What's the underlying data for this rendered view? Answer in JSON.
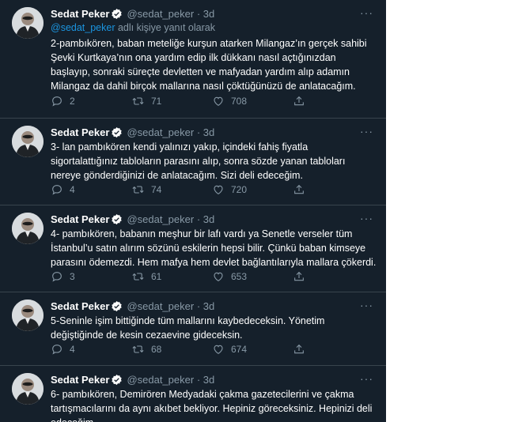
{
  "reply_prefix": {
    "mention": "@sedat_peker",
    "suffix": " adlı kişiye yanıt olarak"
  },
  "tweets": [
    {
      "name": "Sedat Peker",
      "handle": "@sedat_peker",
      "dot": "·",
      "time": "3d",
      "text": "2-pambıkören, baban meteliğe kurşun atarken Milangaz’ın gerçek sahibi Şevki Kurtkaya’nın ona yardım edip ilk dükkanı nasıl açtığınızdan başlayıp, sonraki süreçte devletten ve mafyadan yardım alıp adamın Milangaz da dahil birçok mallarına nasıl çöktüğünüzü de anlatacağım.",
      "replies": "2",
      "retweets": "71",
      "likes": "708"
    },
    {
      "name": "Sedat Peker",
      "handle": "@sedat_peker",
      "dot": "·",
      "time": "3d",
      "text": "3- lan pambıkören kendi yalınızı yakıp, içindeki fahiş fiyatla sigortalattığınız tabloların parasını alıp, sonra sözde yanan tabloları nereye gönderdiğinizi de anlatacağım. Sizi deli edeceğim.",
      "replies": "4",
      "retweets": "74",
      "likes": "720"
    },
    {
      "name": "Sedat Peker",
      "handle": "@sedat_peker",
      "dot": "·",
      "time": "3d",
      "text": "4- pambıkören, babanın meşhur bir lafı vardı ya Senetle verseler tüm İstanbul’u satın alırım sözünü eskilerin hepsi bilir. Çünkü baban kimseye parasını ödemezdi. Hem mafya hem devlet bağlantılarıyla mallara çökerdi.",
      "replies": "3",
      "retweets": "61",
      "likes": "653"
    },
    {
      "name": "Sedat Peker",
      "handle": "@sedat_peker",
      "dot": "·",
      "time": "3d",
      "text": "5-Seninle işim bittiğinde tüm mallarını kaybedeceksin. Yönetim değiştiğinde de kesin cezaevine gideceksin.",
      "replies": "4",
      "retweets": "68",
      "likes": "674"
    },
    {
      "name": "Sedat Peker",
      "handle": "@sedat_peker",
      "dot": "·",
      "time": "3d",
      "text": "6- pambıkören, Demirören Medyadaki çakma gazetecilerini ve çakma tartışmacılarını da aynı akıbet bekliyor. Hepiniz göreceksiniz. Hepinizi deli edeceğim."
    }
  ],
  "colors": {
    "background": "#15202b",
    "text": "#ffffff",
    "secondary": "#8899a6",
    "link": "#1b95e0",
    "divider": "#38444d",
    "verified": "#1da1f2"
  },
  "icons": [
    "verified-badge-icon",
    "more-options-icon",
    "reply-icon",
    "retweet-icon",
    "like-icon",
    "share-icon"
  ]
}
